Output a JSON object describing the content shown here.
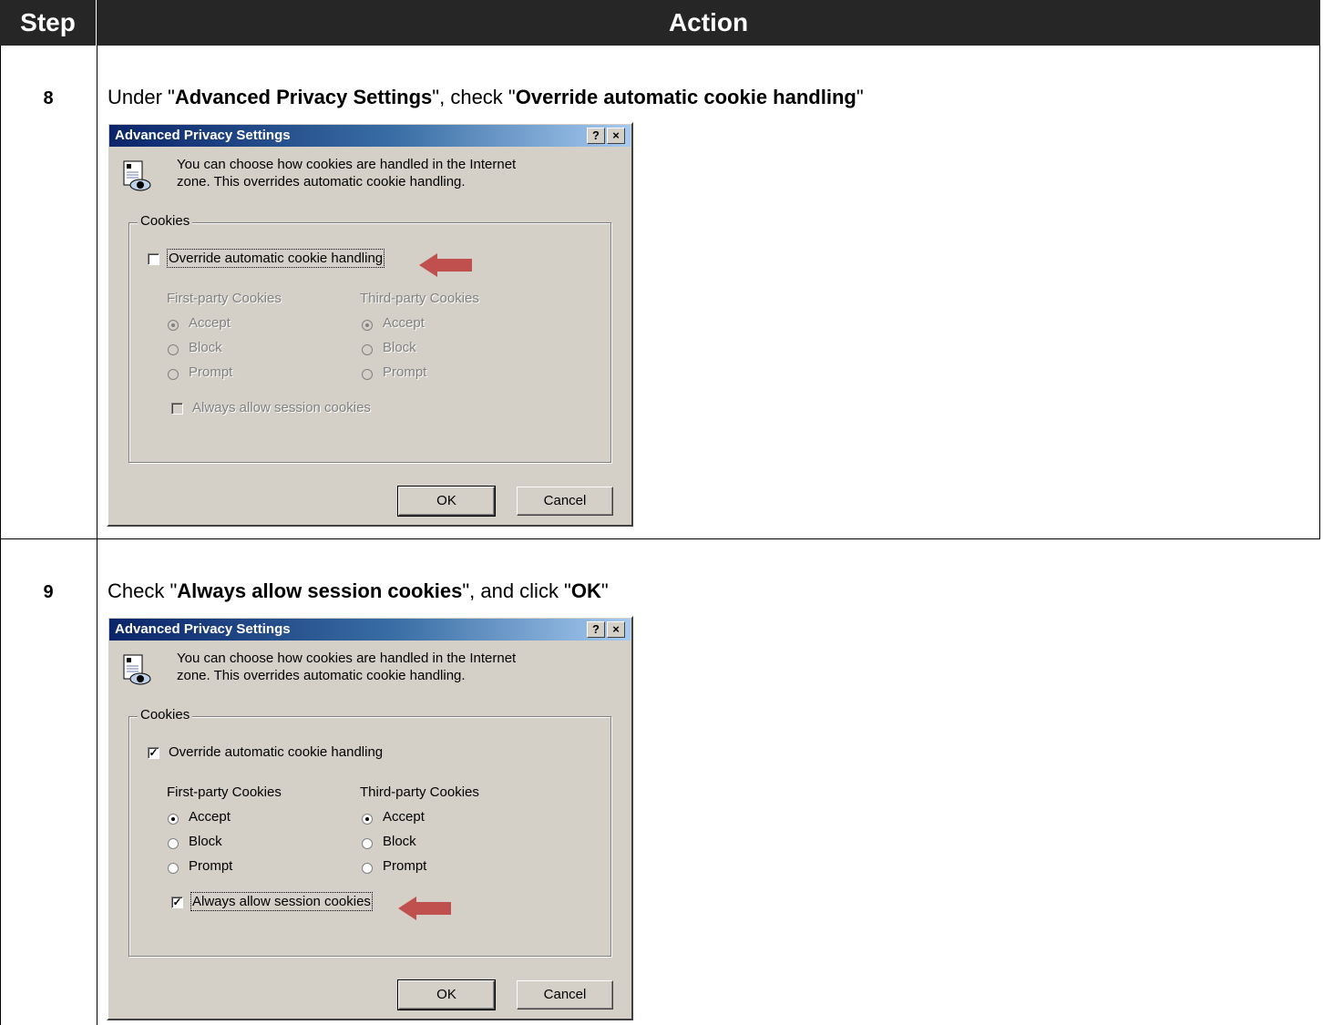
{
  "header": {
    "step": "Step",
    "action": "Action"
  },
  "steps": [
    {
      "number": "8",
      "instruction": {
        "pre": "Under \"",
        "b1": "Advanced Privacy Settings",
        "mid": "\", check \"",
        "b2": "Override automatic cookie handling",
        "post": "\""
      },
      "dialog": {
        "title": "Advanced Privacy Settings",
        "help_btn": "?",
        "close_btn": "×",
        "intro_line1": "You can choose how cookies are handled in the Internet",
        "intro_line2": "zone.  This overrides automatic cookie handling.",
        "group_label": "Cookies",
        "override_label": "Override automatic cookie handling",
        "override_checked": false,
        "first_party_header": "First-party Cookies",
        "third_party_header": "Third-party Cookies",
        "options": [
          "Accept",
          "Block",
          "Prompt"
        ],
        "first_party_selected": "Accept",
        "third_party_selected": "Accept",
        "session_label": "Always allow session cookies",
        "session_checked": false,
        "ok": "OK",
        "cancel": "Cancel",
        "controls_enabled": false
      }
    },
    {
      "number": "9",
      "instruction": {
        "pre": "Check \"",
        "b1": "Always allow session cookies",
        "mid": "\", and click \"",
        "b2": "OK",
        "post": "\""
      },
      "dialog": {
        "title": "Advanced Privacy Settings",
        "help_btn": "?",
        "close_btn": "×",
        "intro_line1": "You can choose how cookies are handled in the Internet",
        "intro_line2": "zone.  This overrides automatic cookie handling.",
        "group_label": "Cookies",
        "override_label": "Override automatic cookie handling",
        "override_checked": true,
        "first_party_header": "First-party Cookies",
        "third_party_header": "Third-party Cookies",
        "options": [
          "Accept",
          "Block",
          "Prompt"
        ],
        "first_party_selected": "Accept",
        "third_party_selected": "Accept",
        "session_label": "Always allow session cookies",
        "session_checked": true,
        "ok": "OK",
        "cancel": "Cancel",
        "controls_enabled": true
      }
    }
  ],
  "colors": {
    "header_bg": "#262626",
    "arrow": "#c0504d",
    "dialog_bg": "#d4d0c8",
    "titlebar_start": "#0a246a"
  }
}
